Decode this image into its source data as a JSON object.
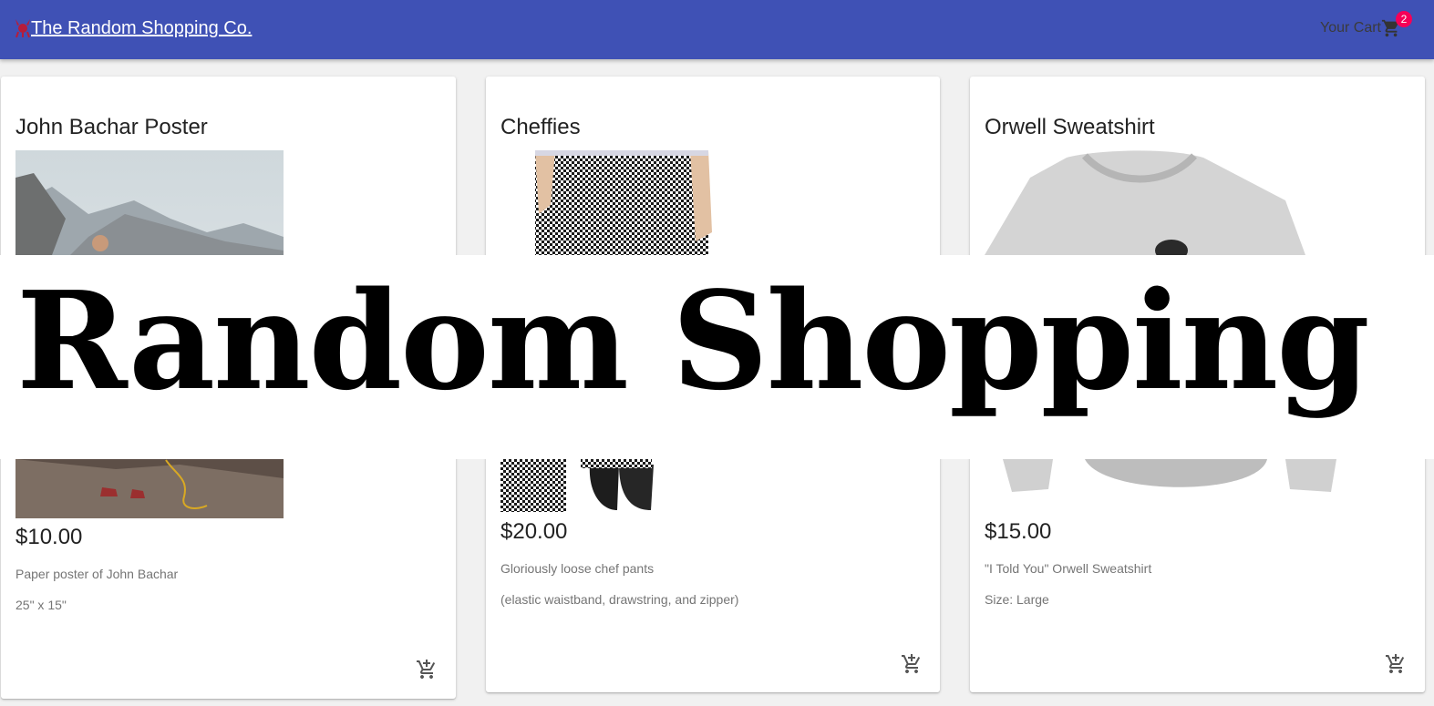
{
  "header": {
    "brand_label": "The Random Shopping Co.",
    "cart_label": "Your Cart",
    "cart_count": "2",
    "bar_color": "#3f51b5",
    "badge_color": "#f50057"
  },
  "banner": {
    "text": "Random Shopping"
  },
  "products": [
    {
      "title": "John Bachar Poster",
      "price": "$10.00",
      "desc_line1": "Paper poster of John Bachar",
      "desc_line2": "25\" x 15\""
    },
    {
      "title": "Cheffies",
      "price": "$20.00",
      "desc_line1": "Gloriously loose chef pants",
      "desc_line2": "(elastic waistband, drawstring, and zipper)"
    },
    {
      "title": "Orwell Sweatshirt",
      "price": "$15.00",
      "desc_line1": "\"I Told You\" Orwell Sweatshirt",
      "desc_line2": "Size: Large"
    }
  ],
  "icons": {
    "brand": "devil-icon",
    "cart": "shopping-cart-icon",
    "add_to_cart": "add-shopping-cart-icon"
  }
}
